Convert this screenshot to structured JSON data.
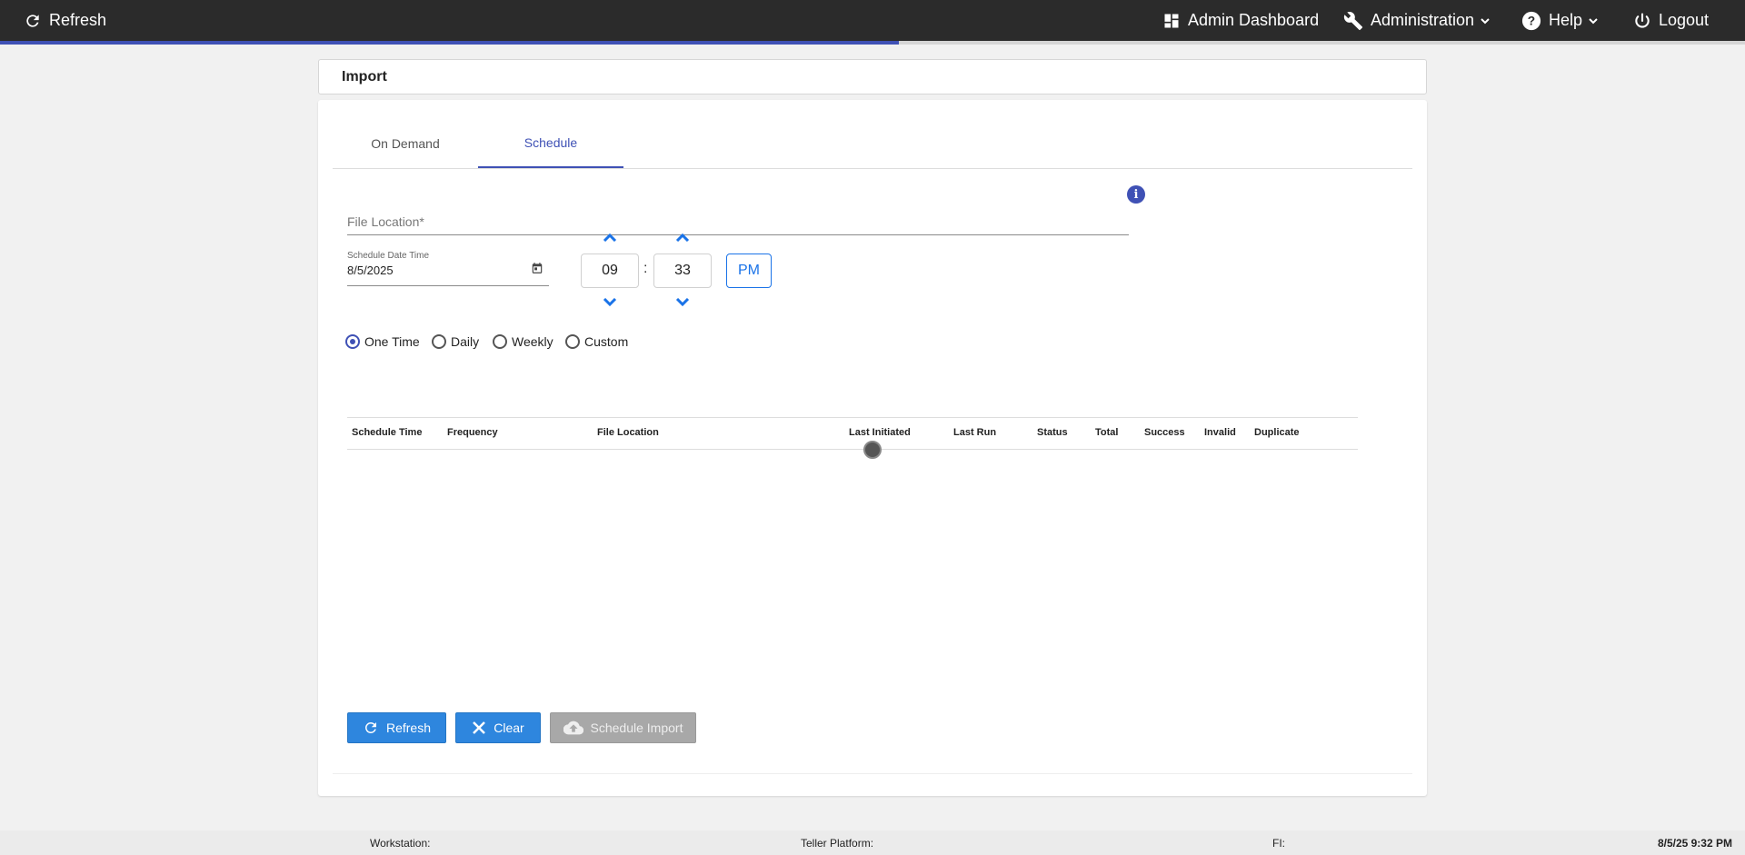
{
  "topbar": {
    "refresh_label": "Refresh",
    "admin_dashboard_label": "Admin Dashboard",
    "administration_label": "Administration",
    "help_label": "Help",
    "logout_label": "Logout",
    "progress_fraction": 0.515
  },
  "header": {
    "title": "Import"
  },
  "tabs": [
    {
      "label": "On Demand",
      "active": false
    },
    {
      "label": "Schedule",
      "active": true
    }
  ],
  "form": {
    "file_location_placeholder": "File Location*",
    "file_location_value": "",
    "schedule_date_label": "Schedule Date Time",
    "schedule_date_value": "8/5/2025",
    "hour": "09",
    "minute": "33",
    "separator": ":",
    "meridiem": "PM"
  },
  "frequency_options": [
    {
      "label": "One Time",
      "checked": true
    },
    {
      "label": "Daily",
      "checked": false
    },
    {
      "label": "Weekly",
      "checked": false
    },
    {
      "label": "Custom",
      "checked": false
    }
  ],
  "table": {
    "columns": [
      "Schedule Time",
      "Frequency",
      "File Location",
      "Last Initiated",
      "Last Run",
      "Status",
      "Total",
      "Success",
      "Invalid",
      "Duplicate"
    ],
    "rows": []
  },
  "buttons": {
    "refresh": "Refresh",
    "clear": "Clear",
    "schedule_import": "Schedule Import"
  },
  "footer": {
    "workstation": "Workstation:",
    "teller_platform": "Teller Platform:",
    "fi": "FI:",
    "datetime": "8/5/25 9:32 PM"
  },
  "colors": {
    "topbar": "#2b2b2b",
    "accent": "#3f51b5",
    "button_blue": "#2e86de",
    "button_disabled": "#a8a8a8"
  }
}
